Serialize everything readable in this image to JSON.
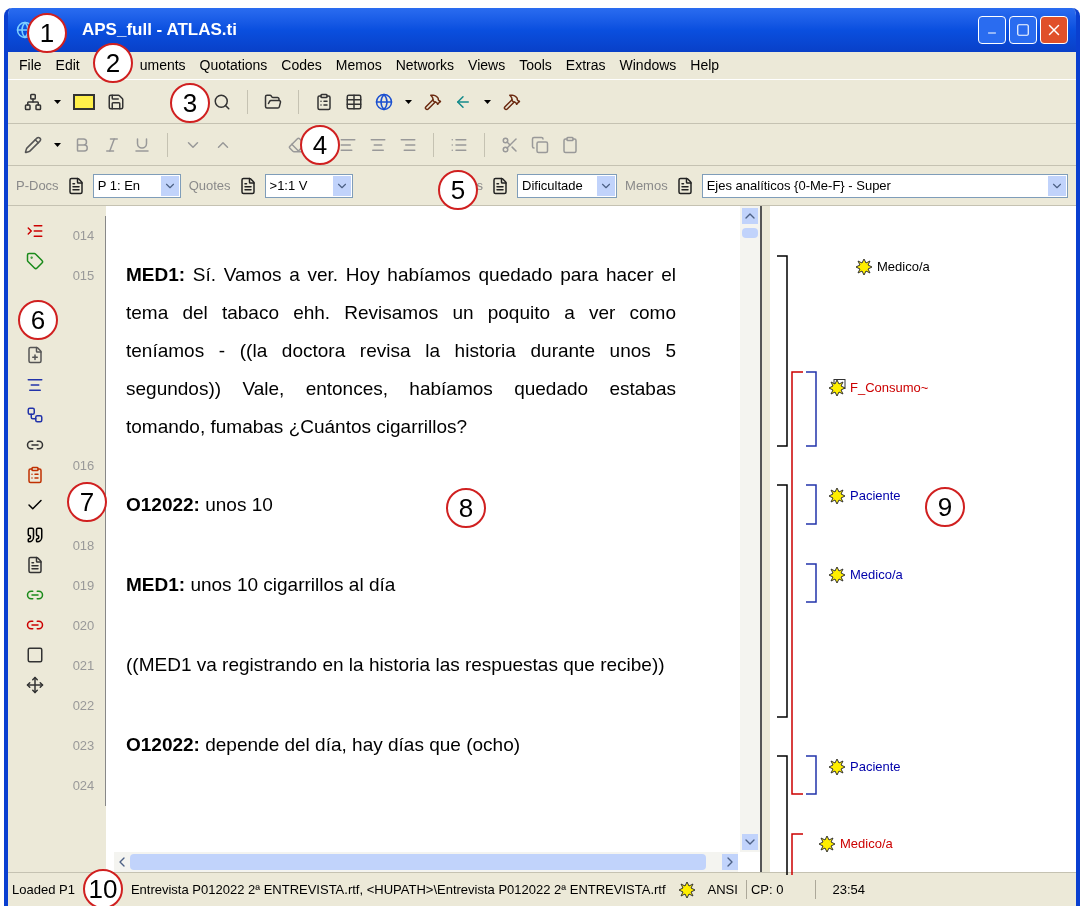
{
  "window": {
    "title": "APS_full - ATLAS.ti"
  },
  "menu": [
    "File",
    "Edit",
    "uments",
    "Quotations",
    "Codes",
    "Memos",
    "Networks",
    "Views",
    "Tools",
    "Extras",
    "Windows",
    "Help"
  ],
  "navigator": [
    {
      "label": "P-Docs",
      "value": "P 1: En"
    },
    {
      "label": "Quotes",
      "value": ">1:1 V"
    },
    {
      "label": "s",
      "value": "Dificultade"
    },
    {
      "label": "Memos",
      "value": "Ejes analíticos {0-Me-F} - Super"
    }
  ],
  "document": {
    "rows": [
      {
        "number": "014",
        "text": ""
      },
      {
        "number": "015",
        "text": "**MED1:** Sí. Vamos a ver. Hoy habíamos quedado para hacer el tema del tabaco ehh. Revisamos un poquito a ver como teníamos - ((la doctora revisa la historia durante unos 5 segundos)) Vale, entonces, habíamos quedado estabas tomando, fumabas ¿Cuántos cigarrillos?"
      },
      {
        "number": "016",
        "text": ""
      },
      {
        "text": "**O12022:** unos 10"
      },
      {
        "number": "018",
        "text": ""
      },
      {
        "number": "019",
        "text": "**MED1:** unos 10 cigarrillos al día"
      },
      {
        "number": "020",
        "text": ""
      },
      {
        "number": "021",
        "text": "((MED1 va registrando en la historia las respuestas que recibe))"
      },
      {
        "number": "022",
        "text": ""
      },
      {
        "number": "023",
        "text": "**O12022:** depende del día, hay días que (ocho)"
      },
      {
        "number": "024",
        "text": ""
      }
    ]
  },
  "margin": [
    {
      "label": "Medico/a",
      "color": "#000000",
      "kind": "code"
    },
    {
      "label": "F_Consumo~",
      "color": "#cc0000",
      "kind": "commented"
    },
    {
      "label": "Paciente",
      "color": "#0000aa",
      "kind": "code"
    },
    {
      "label": "Medico/a",
      "color": "#0000aa",
      "kind": "code"
    },
    {
      "label": "Paciente",
      "color": "#0000aa",
      "kind": "code"
    },
    {
      "label": "Medico/a",
      "color": "#cc0000",
      "kind": "code"
    }
  ],
  "status_bar": {
    "message": "Loaded P1",
    "file": "Entrevista P012022 2ª ENTREVISTA.rtf, <HUPATH>\\Entrevista P012022 2ª ENTREVISTA.rtf",
    "encoding": "ANSI",
    "codepage": "CP: 0",
    "time": "23:54"
  },
  "callouts": [
    "1",
    "2",
    "3",
    "4",
    "5",
    "6",
    "7",
    "8",
    "9",
    "10"
  ]
}
